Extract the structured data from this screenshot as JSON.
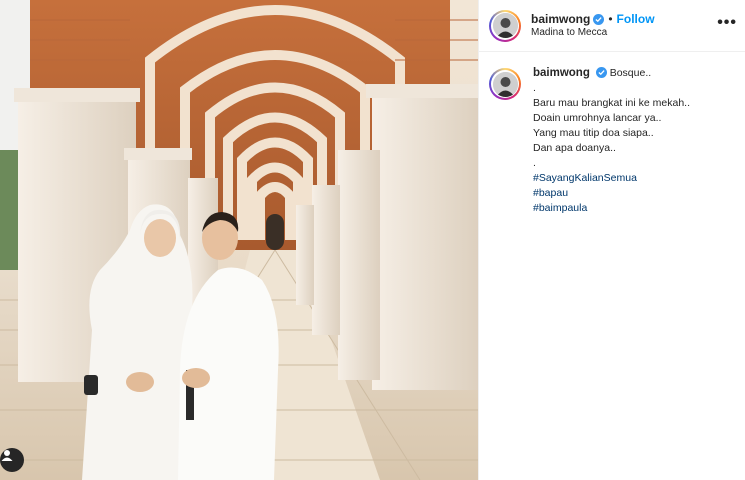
{
  "post": {
    "username": "baimwong",
    "verified_icon": "verified-badge-icon",
    "separator": "•",
    "follow_label": "Follow",
    "location": "Madina to Mecca",
    "more_icon": "more-options-icon",
    "more_glyph": "•••"
  },
  "caption": {
    "username": "baimwong",
    "first_line": "Bosque..",
    "lines": [
      ".",
      "Baru mau brangkat ini ke mekah..",
      "Doain umrohnya lancar ya..",
      "Yang mau titip doa siapa..",
      "Dan apa doanya..",
      "."
    ],
    "hashtags": [
      "#SayangKalianSemua",
      "#bapau",
      "#baimpaula"
    ]
  },
  "photo": {
    "user_tag_icon": "person-tag-icon"
  },
  "colors": {
    "accent_link": "#0095f6",
    "hashtag": "#00376b",
    "verified": "#3897f0",
    "text": "#262626"
  }
}
